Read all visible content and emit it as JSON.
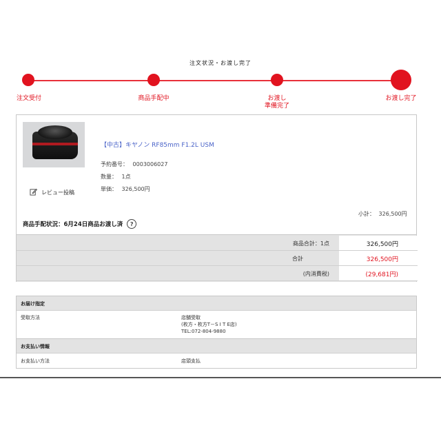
{
  "status_title": "注文状況・お渡し完了",
  "steps": [
    {
      "label": "注文受付"
    },
    {
      "label": "商品手配中"
    },
    {
      "label": "お渡し\n準備完了"
    },
    {
      "label": "お渡し完了"
    }
  ],
  "product": {
    "name": "【中古】キヤノン RF85mm F1.2L USM",
    "reservation_label": "予約番号：",
    "reservation_value": "0003006027",
    "quantity_label": "数量：",
    "quantity_value": "1点",
    "price_label": "単価：",
    "price_value": "326,500円",
    "review_label": "レビュー投稿"
  },
  "subtotal": {
    "label": "小計：",
    "value": "326,500円"
  },
  "arrangement_status": "商品手配状況：6月24日商品お渡し済",
  "totals": [
    {
      "label": "商品合計：1点",
      "value": "326,500円",
      "red": false
    },
    {
      "label": "合計",
      "value": "326,500円",
      "red": true
    },
    {
      "label": "(内消費税)",
      "value": "(29,681円)",
      "red": true
    }
  ],
  "delivery": {
    "header": "お届け指定",
    "row_label": "受取方法",
    "row_value_lines": [
      "店舗受取",
      "(枚方・枚方T－S I T E店)",
      "TEL:072-804-9880"
    ]
  },
  "payment": {
    "header": "お支払い情報",
    "row_label": "お支払い方法",
    "row_value": "店頭支払"
  },
  "colors": {
    "accent": "#e1131f",
    "link": "#4a63c8",
    "panel": "#e3e3e3"
  }
}
